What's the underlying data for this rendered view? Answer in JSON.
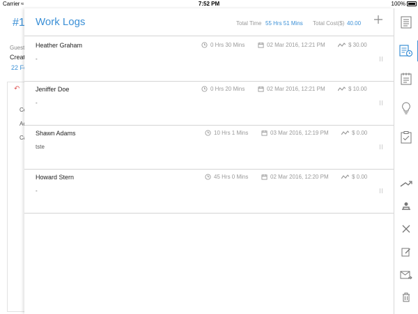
{
  "status_bar": {
    "carrier": "Carrier",
    "time": "7:52 PM",
    "battery": "100%"
  },
  "background_ticket": {
    "id_prefix": "#1",
    "guest_label": "Guest",
    "created_label": "Creat",
    "date_fragment": "22 Fe",
    "rows": [
      "Co",
      "Ac",
      "Ca"
    ]
  },
  "panel": {
    "title": "Work Logs",
    "total_time_label": "Total Time",
    "total_time_value": "55 Hrs 51 Mins",
    "total_cost_label": "Total Cost($)",
    "total_cost_value": "40.00",
    "add_icon": "plus-icon"
  },
  "logs": [
    {
      "name": "Heather Graham",
      "duration": "0 Hrs 30 Mins",
      "date": "02 Mar 2016, 12:21 PM",
      "cost": "$ 30.00",
      "note": "-"
    },
    {
      "name": "Jeniffer Doe",
      "duration": "0 Hrs 20 Mins",
      "date": "02 Mar 2016, 12:21 PM",
      "cost": "$ 10.00",
      "note": "-"
    },
    {
      "name": "Shawn Adams",
      "duration": "10 Hrs  1 Mins",
      "date": "03 Mar 2016, 12:19 PM",
      "cost": "$ 0.00",
      "note": "tste"
    },
    {
      "name": "Howard Stern",
      "duration": "45 Hrs  0 Mins",
      "date": "02 Mar 2016, 12:20 PM",
      "cost": "$ 0.00",
      "note": "-"
    }
  ],
  "sidebar": {
    "items": [
      "details-icon",
      "work-log-icon",
      "calendar-notes-icon",
      "lightbulb-icon",
      "checklist-icon",
      "forward-icon",
      "assign-icon",
      "close-icon",
      "edit-icon",
      "mail-reply-icon",
      "trash-icon"
    ],
    "active": "work-log-icon"
  },
  "colors": {
    "accent": "#3a8fd6",
    "muted": "#999999",
    "divider": "#d4d4d4"
  }
}
